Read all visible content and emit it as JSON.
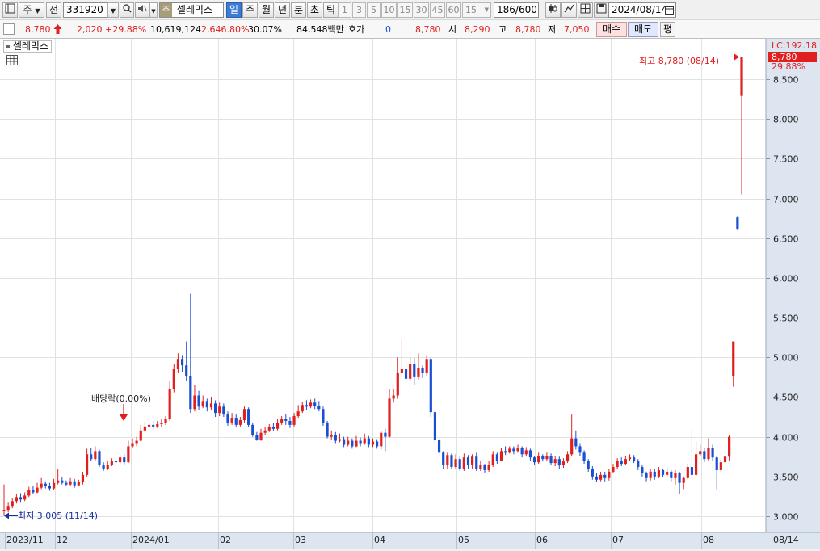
{
  "toolbar": {
    "type_label": "주",
    "prev_label": "전",
    "code_value": "331920",
    "stock_badge": "주",
    "stock_name": "셀레믹스",
    "timeframes": [
      "일",
      "주",
      "월",
      "년",
      "분",
      "초",
      "틱"
    ],
    "active_timeframe": "일",
    "periods": [
      "1",
      "3",
      "5",
      "10",
      "15",
      "30",
      "45",
      "60"
    ],
    "period_select": "15",
    "count_current": "186",
    "count_total": "/600",
    "date_value": "2024/08/14"
  },
  "quote": {
    "price": "8,780",
    "change": "2,020",
    "change_pct": "+29.88%",
    "volume": "10,619,124",
    "volume_ratio": "2,646.80%",
    "turnover": "30.07%",
    "trade_value": "84,548백만",
    "bid_label": "호가",
    "bid_value": "0",
    "ask_value": "8,780",
    "open_label": "시",
    "open_value": "8,290",
    "high_label": "고",
    "high_value": "8,780",
    "low_label": "저",
    "low_value": "7,050",
    "buy_button": "매수",
    "sell_button": "매도",
    "avg_button": "평"
  },
  "chart_data": {
    "type": "candlestick",
    "title": "셀레믹스",
    "lc_label": "LC:192.18",
    "last_price_label": "8,780",
    "last_change_label": "29.88%",
    "high_annotation": "최고 8,780 (08/14)",
    "low_annotation": "최저 3,005 (11/14)",
    "dividend_annotation": "배당락(0.00%)",
    "ylim": [
      2800,
      8900
    ],
    "y_ticks": [
      3000,
      3500,
      4000,
      4500,
      5000,
      5500,
      6000,
      6500,
      7000,
      7500,
      8000,
      8500
    ],
    "x_labels": [
      "2023/11",
      "12",
      "2024/01",
      "02",
      "03",
      "04",
      "05",
      "06",
      "07",
      "08"
    ],
    "x_end_label": "08/14",
    "up_color": "#e01f1f",
    "down_color": "#1a4fd1",
    "candles": [
      [
        3070,
        3080,
        3400,
        3005
      ],
      [
        3080,
        3130,
        3180,
        3050
      ],
      [
        3130,
        3190,
        3230,
        3100
      ],
      [
        3190,
        3240,
        3280,
        3160
      ],
      [
        3240,
        3210,
        3290,
        3180
      ],
      [
        3210,
        3260,
        3300,
        3190
      ],
      [
        3260,
        3330,
        3370,
        3240
      ],
      [
        3330,
        3300,
        3380,
        3280
      ],
      [
        3300,
        3360,
        3420,
        3290
      ],
      [
        3360,
        3410,
        3480,
        3340
      ],
      [
        3410,
        3380,
        3440,
        3350
      ],
      [
        3380,
        3350,
        3420,
        3320
      ],
      [
        3350,
        3420,
        3470,
        3330
      ],
      [
        3420,
        3450,
        3600,
        3400
      ],
      [
        3450,
        3420,
        3490,
        3400
      ],
      [
        3420,
        3400,
        3450,
        3380
      ],
      [
        3400,
        3440,
        3480,
        3380
      ],
      [
        3440,
        3390,
        3470,
        3360
      ],
      [
        3390,
        3430,
        3460,
        3380
      ],
      [
        3430,
        3520,
        3560,
        3400
      ],
      [
        3520,
        3780,
        3850,
        3500
      ],
      [
        3780,
        3720,
        3860,
        3700
      ],
      [
        3720,
        3820,
        3880,
        3700
      ],
      [
        3820,
        3650,
        3840,
        3620
      ],
      [
        3650,
        3600,
        3680,
        3570
      ],
      [
        3600,
        3650,
        3700,
        3580
      ],
      [
        3650,
        3700,
        3730,
        3630
      ],
      [
        3700,
        3680,
        3750,
        3640
      ],
      [
        3680,
        3740,
        3770,
        3660
      ],
      [
        3740,
        3680,
        3780,
        3640
      ],
      [
        3680,
        3880,
        3950,
        3670
      ],
      [
        3880,
        3920,
        3980,
        3860
      ],
      [
        3920,
        3950,
        4000,
        3880
      ],
      [
        3950,
        4080,
        4150,
        3940
      ],
      [
        4080,
        4130,
        4190,
        4060
      ],
      [
        4130,
        4150,
        4190,
        4100
      ],
      [
        4150,
        4130,
        4200,
        4090
      ],
      [
        4130,
        4160,
        4200,
        4110
      ],
      [
        4160,
        4170,
        4230,
        4120
      ],
      [
        4170,
        4230,
        4260,
        4150
      ],
      [
        4230,
        4600,
        4700,
        4200
      ],
      [
        4600,
        4850,
        4920,
        4560
      ],
      [
        4850,
        4980,
        5050,
        4800
      ],
      [
        4980,
        4900,
        5020,
        4820
      ],
      [
        4900,
        4760,
        5200,
        4700
      ],
      [
        4760,
        4350,
        5800,
        4300
      ],
      [
        4350,
        4520,
        4650,
        4320
      ],
      [
        4520,
        4380,
        4580,
        4340
      ],
      [
        4380,
        4450,
        4520,
        4360
      ],
      [
        4450,
        4370,
        4480,
        4320
      ],
      [
        4370,
        4420,
        4500,
        4340
      ],
      [
        4420,
        4300,
        4460,
        4250
      ],
      [
        4300,
        4380,
        4430,
        4260
      ],
      [
        4380,
        4280,
        4420,
        4250
      ],
      [
        4280,
        4180,
        4320,
        4140
      ],
      [
        4180,
        4240,
        4300,
        4150
      ],
      [
        4240,
        4150,
        4280,
        4120
      ],
      [
        4150,
        4210,
        4250,
        4130
      ],
      [
        4210,
        4350,
        4380,
        4180
      ],
      [
        4350,
        4150,
        4370,
        4120
      ],
      [
        4150,
        4020,
        4180,
        4000
      ],
      [
        4020,
        3960,
        4060,
        3950
      ],
      [
        3960,
        4050,
        4100,
        3950
      ],
      [
        4050,
        4080,
        4120,
        4020
      ],
      [
        4080,
        4120,
        4160,
        4060
      ],
      [
        4120,
        4100,
        4170,
        4070
      ],
      [
        4100,
        4180,
        4220,
        4080
      ],
      [
        4180,
        4230,
        4260,
        4150
      ],
      [
        4230,
        4200,
        4280,
        4150
      ],
      [
        4200,
        4150,
        4250,
        4110
      ],
      [
        4150,
        4260,
        4300,
        4130
      ],
      [
        4260,
        4320,
        4400,
        4240
      ],
      [
        4320,
        4400,
        4440,
        4300
      ],
      [
        4400,
        4380,
        4460,
        4340
      ],
      [
        4380,
        4430,
        4470,
        4360
      ],
      [
        4430,
        4390,
        4480,
        4350
      ],
      [
        4390,
        4350,
        4450,
        4320
      ],
      [
        4350,
        4180,
        4380,
        4140
      ],
      [
        4180,
        4000,
        4200,
        3980
      ],
      [
        4000,
        4020,
        4080,
        3960
      ],
      [
        4020,
        3950,
        4060,
        3920
      ],
      [
        3950,
        3970,
        4040,
        3930
      ],
      [
        3970,
        3900,
        4000,
        3870
      ],
      [
        3900,
        3950,
        4000,
        3880
      ],
      [
        3950,
        3880,
        3980,
        3850
      ],
      [
        3880,
        3950,
        4010,
        3870
      ],
      [
        3950,
        3920,
        3990,
        3880
      ],
      [
        3920,
        3980,
        4040,
        3900
      ],
      [
        3980,
        3900,
        4010,
        3870
      ],
      [
        3900,
        3940,
        3980,
        3870
      ],
      [
        3940,
        3880,
        3970,
        3850
      ],
      [
        3880,
        4050,
        4070,
        3840
      ],
      [
        4050,
        4000,
        4100,
        3820
      ],
      [
        4000,
        4480,
        4600,
        3990
      ],
      [
        4480,
        4520,
        4600,
        4430
      ],
      [
        4520,
        4800,
        5000,
        4480
      ],
      [
        4800,
        4850,
        5230,
        4750
      ],
      [
        4850,
        4730,
        4970,
        4680
      ],
      [
        4730,
        4920,
        5000,
        4700
      ],
      [
        4920,
        4750,
        4990,
        4650
      ],
      [
        4750,
        4870,
        5050,
        4720
      ],
      [
        4870,
        4800,
        4900,
        4740
      ],
      [
        4800,
        4980,
        5020,
        4760
      ],
      [
        4980,
        4310,
        5000,
        4250
      ],
      [
        4310,
        3960,
        4350,
        3900
      ],
      [
        3960,
        3800,
        3990,
        3760
      ],
      [
        3800,
        3640,
        3820,
        3600
      ],
      [
        3640,
        3770,
        3800,
        3600
      ],
      [
        3770,
        3620,
        3790,
        3590
      ],
      [
        3620,
        3720,
        3780,
        3600
      ],
      [
        3720,
        3600,
        3750,
        3570
      ],
      [
        3600,
        3740,
        3790,
        3570
      ],
      [
        3740,
        3650,
        3770,
        3600
      ],
      [
        3650,
        3750,
        3780,
        3600
      ],
      [
        3750,
        3600,
        3800,
        3570
      ],
      [
        3600,
        3640,
        3700,
        3570
      ],
      [
        3640,
        3580,
        3660,
        3550
      ],
      [
        3580,
        3640,
        3700,
        3560
      ],
      [
        3640,
        3780,
        3820,
        3620
      ],
      [
        3780,
        3700,
        3800,
        3660
      ],
      [
        3700,
        3820,
        3860,
        3690
      ],
      [
        3820,
        3800,
        3880,
        3770
      ],
      [
        3800,
        3850,
        3880,
        3790
      ],
      [
        3850,
        3820,
        3880,
        3780
      ],
      [
        3820,
        3860,
        3900,
        3800
      ],
      [
        3860,
        3780,
        3880,
        3740
      ],
      [
        3780,
        3830,
        3870,
        3760
      ],
      [
        3830,
        3740,
        3850,
        3700
      ],
      [
        3740,
        3680,
        3760,
        3640
      ],
      [
        3680,
        3760,
        3800,
        3660
      ],
      [
        3760,
        3720,
        3780,
        3690
      ],
      [
        3720,
        3760,
        3800,
        3690
      ],
      [
        3760,
        3670,
        3790,
        3640
      ],
      [
        3670,
        3720,
        3760,
        3630
      ],
      [
        3720,
        3640,
        3750,
        3600
      ],
      [
        3640,
        3690,
        3730,
        3610
      ],
      [
        3690,
        3780,
        3820,
        3670
      ],
      [
        3780,
        3980,
        4280,
        3760
      ],
      [
        3980,
        3880,
        4080,
        3840
      ],
      [
        3880,
        3800,
        3920,
        3760
      ],
      [
        3800,
        3700,
        3830,
        3660
      ],
      [
        3700,
        3600,
        3720,
        3560
      ],
      [
        3600,
        3500,
        3630,
        3460
      ],
      [
        3500,
        3460,
        3540,
        3430
      ],
      [
        3460,
        3520,
        3560,
        3440
      ],
      [
        3520,
        3480,
        3560,
        3440
      ],
      [
        3480,
        3560,
        3600,
        3450
      ],
      [
        3560,
        3620,
        3660,
        3540
      ],
      [
        3620,
        3700,
        3730,
        3600
      ],
      [
        3700,
        3660,
        3740,
        3630
      ],
      [
        3660,
        3720,
        3760,
        3640
      ],
      [
        3720,
        3740,
        3780,
        3700
      ],
      [
        3740,
        3700,
        3770,
        3670
      ],
      [
        3700,
        3620,
        3720,
        3580
      ],
      [
        3620,
        3540,
        3640,
        3500
      ],
      [
        3540,
        3480,
        3560,
        3440
      ],
      [
        3480,
        3560,
        3600,
        3450
      ],
      [
        3560,
        3500,
        3590,
        3460
      ],
      [
        3500,
        3580,
        3620,
        3480
      ],
      [
        3580,
        3520,
        3600,
        3490
      ],
      [
        3520,
        3560,
        3610,
        3500
      ],
      [
        3560,
        3480,
        3580,
        3440
      ],
      [
        3480,
        3540,
        3580,
        3400
      ],
      [
        3540,
        3420,
        3560,
        3280
      ],
      [
        3420,
        3480,
        3500,
        3340
      ],
      [
        3480,
        3620,
        3660,
        3460
      ],
      [
        3620,
        3520,
        4100,
        3480
      ],
      [
        3520,
        3780,
        3940,
        3500
      ],
      [
        3780,
        3820,
        3900,
        3760
      ],
      [
        3820,
        3720,
        3860,
        3680
      ],
      [
        3720,
        3860,
        3980,
        3700
      ],
      [
        3860,
        3740,
        3900,
        3700
      ],
      [
        3740,
        3580,
        3760,
        3340
      ],
      [
        3580,
        3680,
        3720,
        3560
      ],
      [
        3680,
        3750,
        3780,
        3650
      ],
      [
        3750,
        4000,
        4020,
        3700
      ],
      [
        4760,
        5200,
        5200,
        4630
      ],
      [
        6760,
        6620,
        6780,
        6600
      ],
      [
        8290,
        8780,
        8780,
        7050
      ]
    ]
  }
}
